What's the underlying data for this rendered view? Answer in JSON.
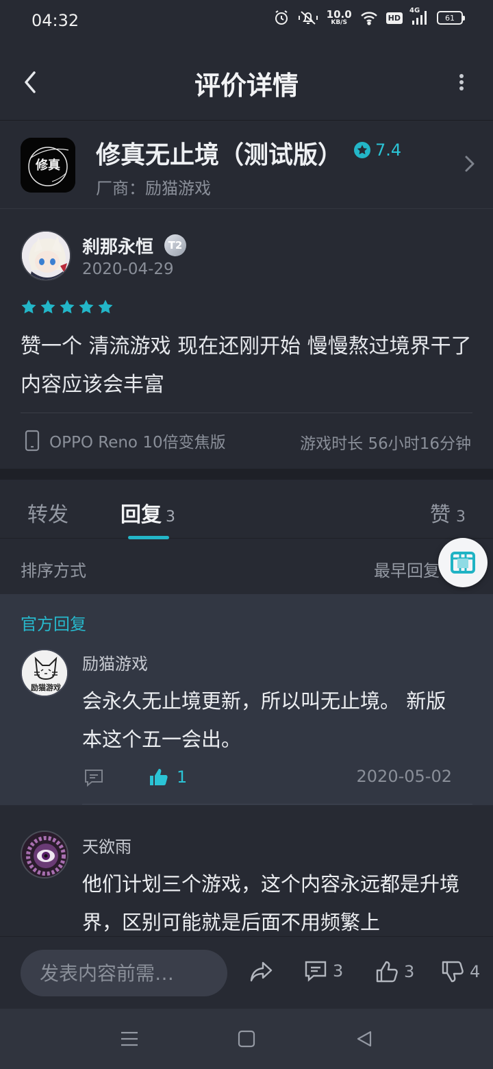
{
  "status_bar": {
    "time": "04:32",
    "net_speed_value": "10.0",
    "net_speed_unit": "KB/S",
    "hd_label": "HD",
    "network_label": "4G",
    "battery_level": "61",
    "icons": [
      "alarm-icon",
      "mute-icon",
      "wifi-icon",
      "signal-icon",
      "battery-icon"
    ]
  },
  "header": {
    "title": "评价详情"
  },
  "app": {
    "name": "修真无止境（测试版）",
    "rating": "7.4",
    "vendor": "厂商：励猫游戏",
    "icon_text": "修真"
  },
  "review": {
    "author": "刹那永恒",
    "level_badge": "T2",
    "date": "2020-04-29",
    "stars": 5,
    "text": "赞一个 清流游戏 现在还刚开始 慢慢熬过境界干了内容应该会丰富",
    "device": "OPPO Reno 10倍变焦版",
    "playtime": "游戏时长 56小时16分钟"
  },
  "tabs": {
    "forward_label": "转发",
    "reply_label": "回复",
    "reply_count": "3",
    "likes_label": "赞",
    "likes_count": "3"
  },
  "sort": {
    "label": "排序方式",
    "value": "最早回复"
  },
  "official_reply": {
    "section_label": "官方回复",
    "author": "励猫游戏",
    "avatar_text": "励猫游戏",
    "text": "会永久无止境更新，所以叫无止境。 新版本这个五一会出。",
    "likes": "1",
    "date": "2020-05-02"
  },
  "reply2": {
    "author": "天欲雨",
    "text": "他们计划三个游戏，这个内容永远都是升境界，区别可能就是后面不用频繁上"
  },
  "action_bar": {
    "input_placeholder": "发表内容前需…",
    "comment_count": "3",
    "like_count": "3",
    "dislike_count": "4"
  },
  "colors": {
    "accent": "#23b6c8",
    "background": "#272a33",
    "official_background": "#323743"
  }
}
